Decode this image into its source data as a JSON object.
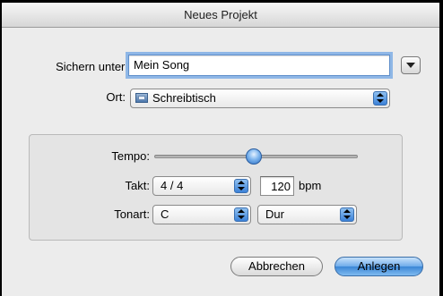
{
  "dialog": {
    "title": "Neues Projekt",
    "save_as": {
      "label": "Sichern unter:",
      "value": "Mein Song"
    },
    "location": {
      "label": "Ort:",
      "value": "Schreibtisch"
    },
    "tempo": {
      "label": "Tempo:",
      "slider_value": 0.49
    },
    "time_signature": {
      "label": "Takt:",
      "value": "4 / 4"
    },
    "bpm": {
      "value": "120",
      "unit": "bpm"
    },
    "key": {
      "label": "Tonart:",
      "note": "C",
      "mode": "Dur"
    },
    "buttons": {
      "cancel": "Abbrechen",
      "create": "Anlegen"
    }
  },
  "colors": {
    "accent": "#3b86d6",
    "window_bg": "#ececec"
  },
  "icons": [
    "disclosure-triangle-icon",
    "folder-icon",
    "popup-arrows-icon"
  ]
}
